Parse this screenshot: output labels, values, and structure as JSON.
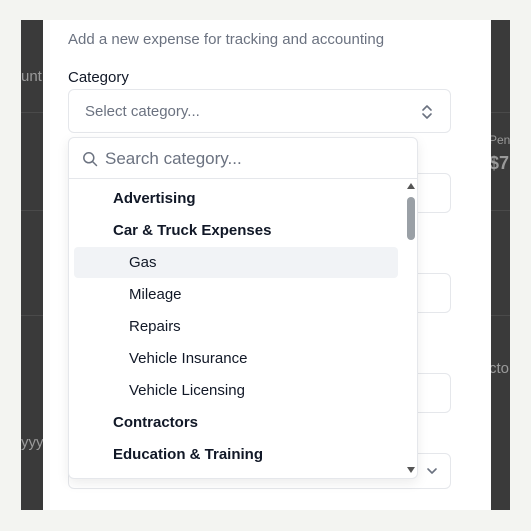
{
  "background": {
    "fragments": [
      "unt",
      "Pen",
      "$7",
      "cto",
      "yyy"
    ]
  },
  "modal": {
    "subtitle": "Add a new expense for tracking and accounting",
    "category_label": "Category",
    "category_select": {
      "value": "Select category..."
    }
  },
  "dropdown": {
    "search": {
      "placeholder": "Search category...",
      "icon": "search-icon"
    },
    "items": [
      {
        "label": "Advertising",
        "type": "group"
      },
      {
        "label": "Car & Truck Expenses",
        "type": "group"
      },
      {
        "label": "Gas",
        "type": "sub",
        "highlighted": true
      },
      {
        "label": "Mileage",
        "type": "sub"
      },
      {
        "label": "Repairs",
        "type": "sub"
      },
      {
        "label": "Vehicle Insurance",
        "type": "sub"
      },
      {
        "label": "Vehicle Licensing",
        "type": "sub"
      },
      {
        "label": "Contractors",
        "type": "group"
      },
      {
        "label": "Education & Training",
        "type": "group"
      }
    ]
  },
  "colors": {
    "overlay": "#3a3a3a",
    "border": "#e5e7eb",
    "muted_text": "#6b7280",
    "text": "#111827",
    "highlight": "#f1f3f6"
  }
}
